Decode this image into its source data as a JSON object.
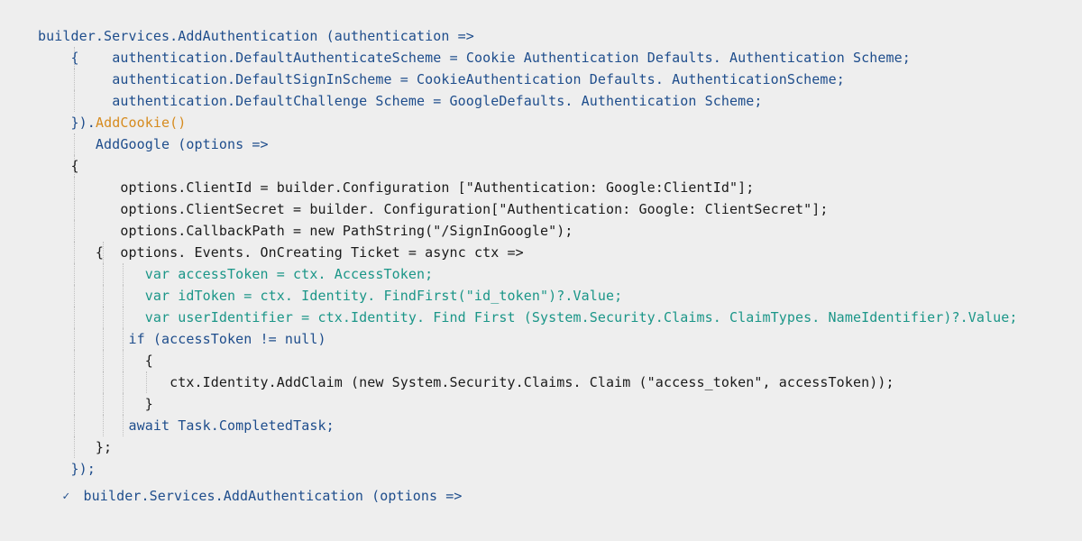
{
  "colors": {
    "blue": "#1e4d8c",
    "orange": "#d68b1f",
    "teal": "#1b9688",
    "black": "#1a1a1a",
    "bg": "#eeeeee"
  },
  "lines": {
    "l1": "builder.Services.AddAuthentication (authentication =>",
    "l2a": "{",
    "l2b": "authentication.DefaultAuthenticateScheme = Cookie Authentication Defaults. Authentication Scheme;",
    "l3": "authentication.DefaultSignInScheme = CookieAuthentication Defaults. AuthenticationScheme;",
    "l4": "authentication.DefaultChallenge Scheme = GoogleDefaults. Authentication Scheme;",
    "l5a": "}).",
    "l5b": "AddCookie()",
    "l6": "AddGoogle (options =>",
    "l7": "{",
    "l8": "options.ClientId = builder.Configuration [\"Authentication: Google:ClientId\"];",
    "l9": "options.ClientSecret = builder. Configuration[\"Authentication: Google: ClientSecret\"];",
    "l10": "options.CallbackPath = new PathString(\"/SignInGoogle\");",
    "l11a": "{",
    "l11b": "options. Events. OnCreating Ticket = async ctx =>",
    "l12": "var accessToken = ctx. AccessToken;",
    "l13": "var idToken = ctx. Identity. FindFirst(\"id_token\")?.Value;",
    "l14": "var userIdentifier = ctx.Identity. Find First (System.Security.Claims. ClaimTypes. NameIdentifier)?.Value;",
    "l15": "if (accessToken != null)",
    "l16": "{",
    "l17": "ctx.Identity.AddClaim (new System.Security.Claims. Claim (\"access_token\", accessToken));",
    "l18": "}",
    "l19": "await Task.CompletedTask;",
    "l20": "};",
    "l21": "});",
    "l22": "builder.Services.AddAuthentication (options =>"
  }
}
